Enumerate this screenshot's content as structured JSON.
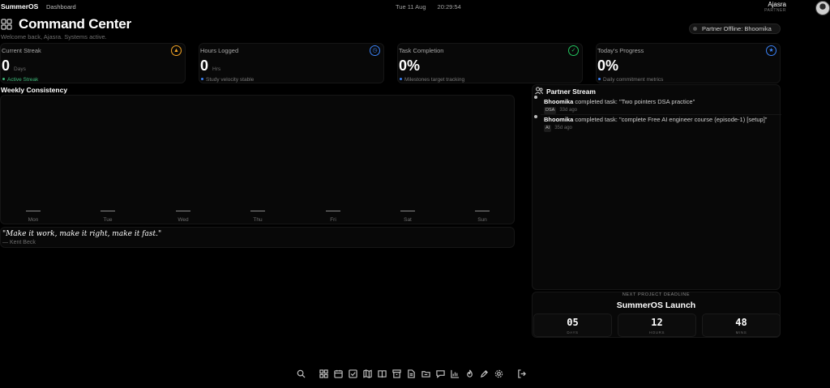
{
  "topbar": {
    "brand": "SummerOS",
    "breadcrumb": "Dashboard",
    "date": "Tue 11 Aug",
    "time": "20:29:54",
    "user_name": "Ajasra",
    "user_role": "PARTNER"
  },
  "header": {
    "title": "Command Center",
    "welcome": "Welcome back, Ajasra. Systems active.",
    "partner_status": "Partner Offline: Bhoomika"
  },
  "stats": [
    {
      "label": "Current Streak",
      "value": "0",
      "unit": "Days",
      "sub": "Active Streak",
      "icon": "flame-icon",
      "accent": "#f5a524",
      "sub_color": "#3fb97a"
    },
    {
      "label": "Hours Logged",
      "value": "0",
      "unit": "Hrs",
      "sub": "Study velocity stable",
      "icon": "clock-icon",
      "accent": "#3b82f6",
      "sub_color": "#7a7a7a"
    },
    {
      "label": "Task Completion",
      "value": "0%",
      "unit": "",
      "sub": "Milestones target tracking",
      "icon": "target-icon",
      "accent": "#22c55e",
      "sub_color": "#7a7a7a"
    },
    {
      "label": "Today's Progress",
      "value": "0%",
      "unit": "",
      "sub": "Daily commitment metrics",
      "icon": "award-icon",
      "accent": "#3b82f6",
      "sub_color": "#7a7a7a"
    }
  ],
  "weekly": {
    "title": "Weekly Consistency",
    "days": [
      "Mon",
      "Tue",
      "Wed",
      "Thu",
      "Fri",
      "Sat",
      "Sun"
    ],
    "values": [
      0,
      0,
      0,
      0,
      0,
      0,
      0
    ]
  },
  "quote": {
    "text": "\"Make it work, make it right, make it fast.\"",
    "author": "— Kent Beck"
  },
  "stream": {
    "title": "Partner Stream",
    "entries": [
      {
        "name": "Bhoomika",
        "action": "completed task: \"Two pointers DSA practice\"",
        "tag": "DSA",
        "ago": "33d ago"
      },
      {
        "name": "Bhoomika",
        "action": "completed task: \"complete Free AI engineer course (episode-1) [setup]\"",
        "tag": "AI",
        "ago": "35d ago"
      }
    ]
  },
  "deadline": {
    "label": "NEXT PROJECT DEADLINE",
    "title": "SummerOS Launch",
    "counters": [
      {
        "value": "05",
        "unit": "DAYS"
      },
      {
        "value": "12",
        "unit": "HOURS"
      },
      {
        "value": "48",
        "unit": "MINS"
      }
    ]
  },
  "dock": [
    "search-icon",
    "dashboard-icon",
    "calendar-icon",
    "tasks-icon",
    "map-icon",
    "book-icon",
    "layout-icon",
    "file-icon",
    "folder-icon",
    "chat-icon",
    "chart-icon",
    "flame-icon",
    "pen-icon",
    "settings-icon",
    "logout-icon"
  ]
}
